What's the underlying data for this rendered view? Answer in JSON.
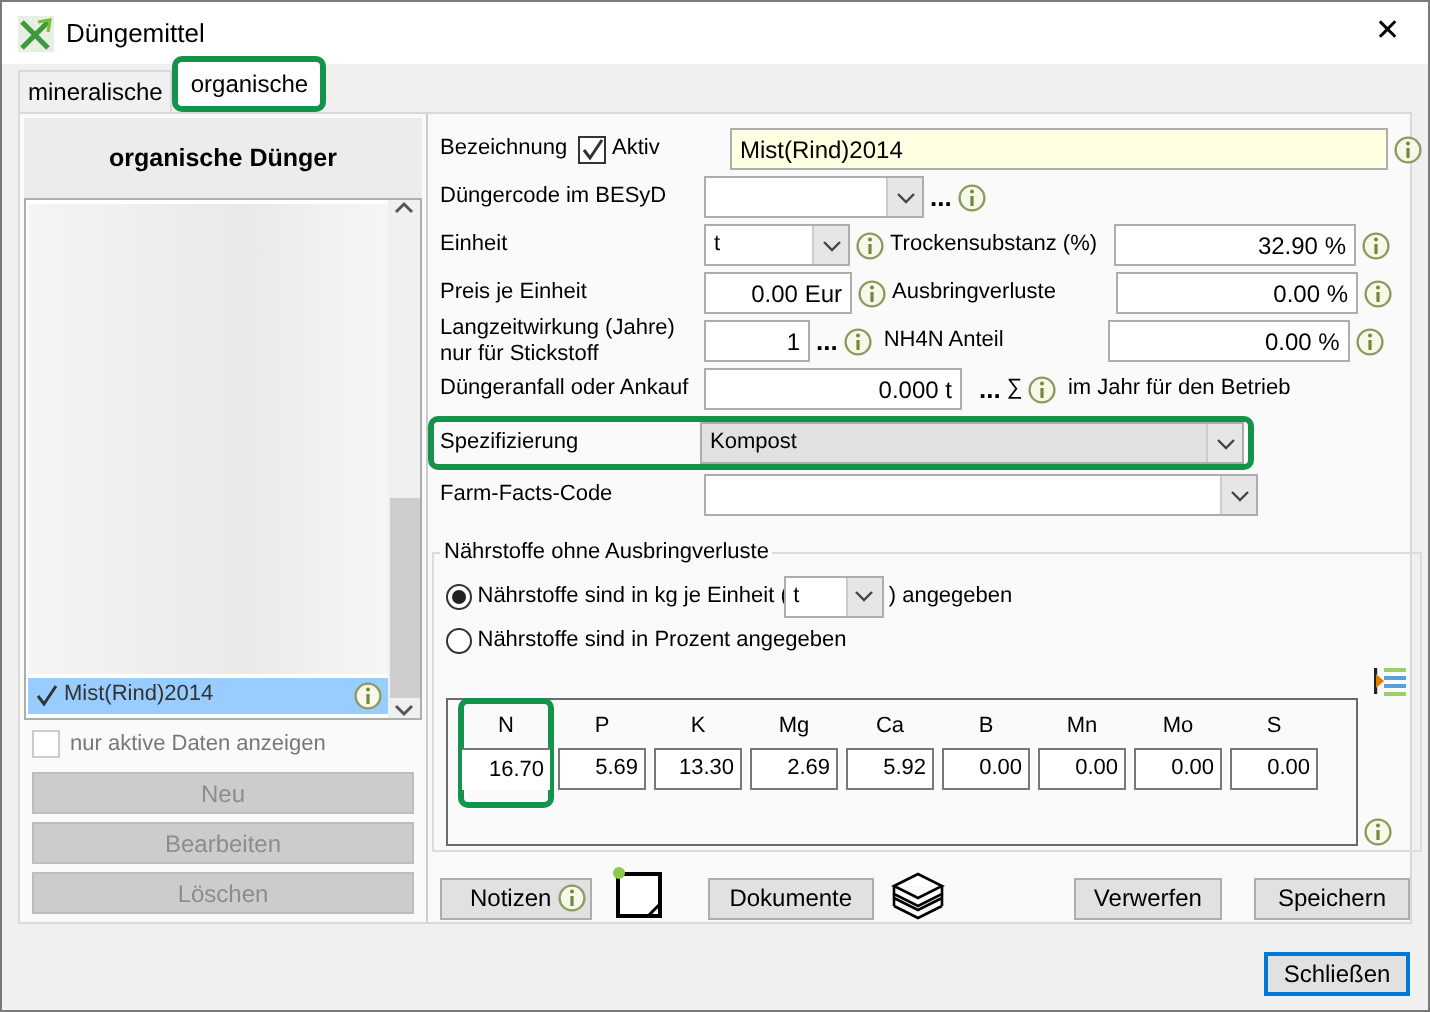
{
  "window": {
    "title": "Düngemittel",
    "close": "✕"
  },
  "tabs": [
    {
      "label": "mineralische",
      "selected": false,
      "highlighted": false
    },
    {
      "label": "organische",
      "selected": true,
      "highlighted": true
    }
  ],
  "list": {
    "heading": "organische Dünger",
    "items": [
      {
        "label": "Mist(Rind)2014",
        "selected": true,
        "checked": true
      }
    ]
  },
  "active_only": {
    "label": "nur aktive Daten anzeigen",
    "checked": false
  },
  "list_buttons": [
    {
      "label": "Neu",
      "disabled": true
    },
    {
      "label": "Bearbeiten",
      "disabled": true
    },
    {
      "label": "Löschen",
      "disabled": true
    }
  ],
  "form": {
    "name": {
      "label": "Bezeichnung",
      "active": {
        "label": "Aktiv",
        "checked": true
      },
      "value": "Mist(Rind)2014"
    },
    "code": {
      "label": "Düngercode im BESyD",
      "more": "..."
    },
    "unit": {
      "label": "Einheit",
      "value": "t"
    },
    "price": {
      "label": "Preis je Einheit",
      "value": "0.00 Eur"
    },
    "longterm": {
      "label": "Langzeitwirkung (Jahre) nur für Stickstoff",
      "value": "1",
      "more": "..."
    },
    "amount": {
      "label": "Düngeranfall oder Ankauf",
      "value": "0.000 t",
      "more": "...",
      "sum": "∑",
      "note": "im Jahr für den Betrieb"
    },
    "spec": {
      "label": "Spezifizierung",
      "value": "Kompost",
      "highlighted": true
    },
    "farm_facts": {
      "label": "Farm-Facts-Code"
    },
    "side_fields": [
      {
        "label": "Trockensubstanz (%)",
        "value": "32.90 %"
      },
      {
        "label": "Ausbringverluste",
        "value": "0.00 %"
      },
      {
        "label": "NH4N Anteil",
        "value": "0.00 %"
      }
    ]
  },
  "nutrients": {
    "title": "Nährstoffe ohne Ausbringverluste",
    "options": [
      {
        "kind": "unit",
        "label_before": "Nährstoffe sind in kg je Einheit (",
        "unit": "t",
        "label_after": ") angegeben",
        "selected": true
      },
      {
        "kind": "plain",
        "label": "Nährstoffe sind in Prozent angegeben",
        "selected": false
      }
    ],
    "columns": [
      {
        "name": "N",
        "value": "16.70",
        "highlighted": true
      },
      {
        "name": "P",
        "value": "5.69",
        "highlighted": false
      },
      {
        "name": "K",
        "value": "13.30",
        "highlighted": false
      },
      {
        "name": "Mg",
        "value": "2.69",
        "highlighted": false
      },
      {
        "name": "Ca",
        "value": "5.92",
        "highlighted": false
      },
      {
        "name": "B",
        "value": "0.00",
        "highlighted": false
      },
      {
        "name": "Mn",
        "value": "0.00",
        "highlighted": false
      },
      {
        "name": "Mo",
        "value": "0.00",
        "highlighted": false
      },
      {
        "name": "S",
        "value": "0.00",
        "highlighted": false
      }
    ]
  },
  "actions": {
    "notes": "Notizen",
    "documents": "Dokumente",
    "discard": "Verwerfen",
    "save": "Speichern"
  },
  "close_button": "Schließen"
}
